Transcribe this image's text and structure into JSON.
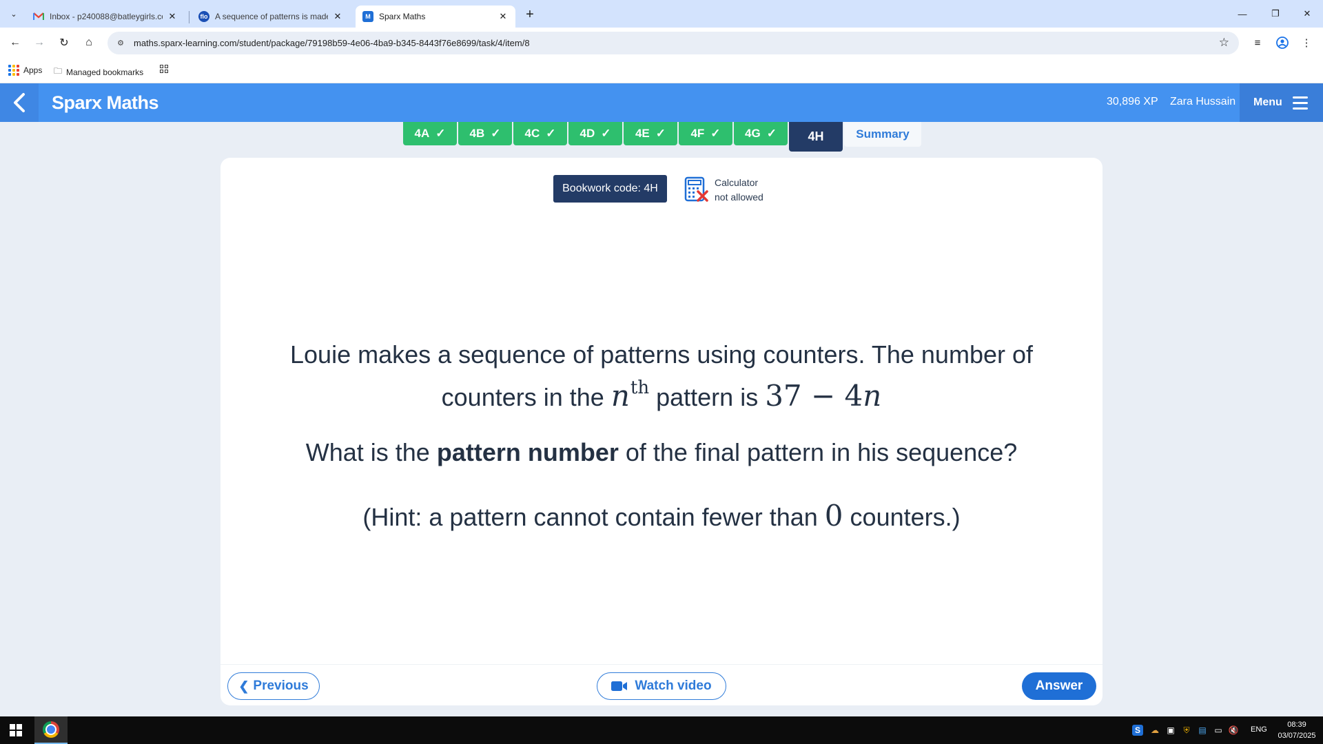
{
  "browser": {
    "tabs": [
      {
        "title": "Inbox - p240088@batleygirls.co",
        "favicon": "gmail-icon",
        "active": false
      },
      {
        "title": "A sequence of patterns is made",
        "favicon": "flo-icon",
        "favicon_text": "flo",
        "active": false
      },
      {
        "title": "Sparx Maths",
        "favicon": "sparx-icon",
        "favicon_text": "M",
        "active": true
      }
    ],
    "url": "maths.sparx-learning.com/student/package/79198b59-4e06-4ba9-b345-8443f76e8699/task/4/item/8",
    "bookmarks": [
      {
        "label": "Apps",
        "icon": "apps-grid-icon"
      },
      {
        "label": "Managed bookmarks",
        "icon": "folder-icon"
      }
    ]
  },
  "header": {
    "brand": "Sparx Maths",
    "xp": "30,896 XP",
    "student_name": "Zara Hussain",
    "menu_label": "Menu"
  },
  "task_tabs": [
    {
      "label": "4A",
      "status": "complete"
    },
    {
      "label": "4B",
      "status": "complete"
    },
    {
      "label": "4C",
      "status": "complete"
    },
    {
      "label": "4D",
      "status": "complete"
    },
    {
      "label": "4E",
      "status": "complete"
    },
    {
      "label": "4F",
      "status": "complete"
    },
    {
      "label": "4G",
      "status": "complete"
    },
    {
      "label": "4H",
      "status": "current"
    },
    {
      "label": "Summary",
      "status": "summary"
    }
  ],
  "question": {
    "bookwork_code": "Bookwork code: 4H",
    "calculator_line1": "Calculator",
    "calculator_line2": "not allowed",
    "line1_a": "Louie makes a sequence of patterns using counters. The number of",
    "line1_b": "counters in the",
    "nth_var": "n",
    "nth_sup": "th",
    "line1_c": "pattern is",
    "expr": "37 − 4",
    "expr_var": "n",
    "line2_a": "What is the",
    "line2_bold": "pattern number",
    "line2_b": "of the final pattern in his sequence?",
    "hint_a": "(Hint: a pattern cannot contain fewer than",
    "hint_num": "0",
    "hint_b": "counters.)"
  },
  "footer": {
    "previous_label": "Previous",
    "watch_video_label": "Watch video",
    "answer_label": "Answer"
  },
  "taskbar": {
    "language": "ENG",
    "time": "08:39",
    "date": "03/07/2025"
  },
  "colors": {
    "header_blue": "#4492f0",
    "complete_green": "#2ebf6e",
    "current_navy": "#233b66",
    "action_blue": "#1f6fd6",
    "calculator_cross_red": "#e53935"
  }
}
